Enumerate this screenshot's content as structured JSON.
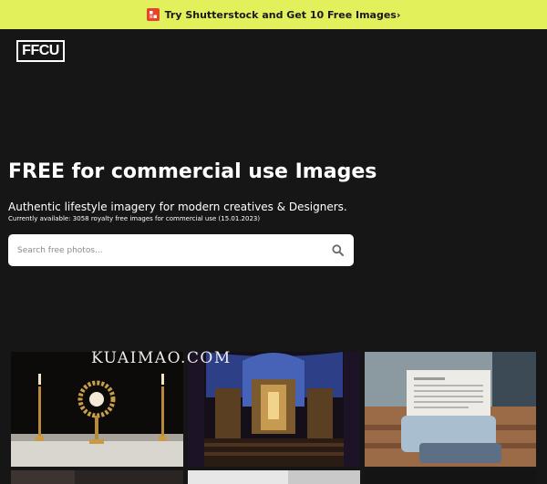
{
  "promo": {
    "text": "Try Shutterstock and Get 10 Free Images›",
    "icon": "shutterstock-icon",
    "accent": "#e2f05c"
  },
  "logo": {
    "text": "FFCU"
  },
  "hero": {
    "title": "FREE for commercial use Images",
    "subtitle": "Authentic lifestyle imagery for modern creatives & Designers.",
    "available": "Currently available: 3058 royalty free images for commercial use (15.01.2023)"
  },
  "search": {
    "placeholder": "Search free photos...",
    "icon": "search-icon"
  },
  "watermark": "KUAIMAO.COM",
  "colors": {
    "background": "#161616",
    "promo_bar": "#e2f05c",
    "promo_icon": "#e8412c"
  }
}
